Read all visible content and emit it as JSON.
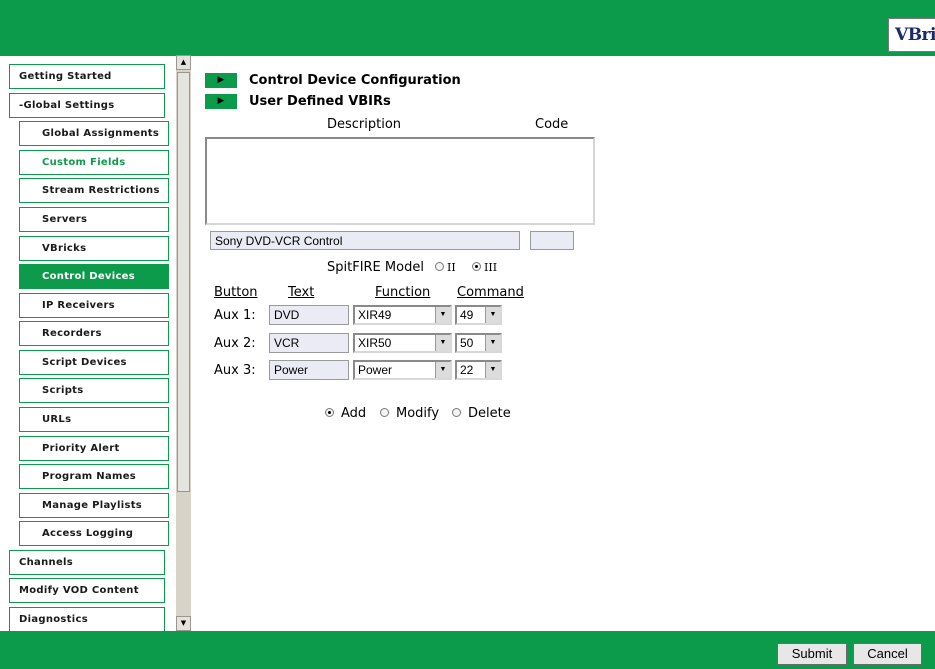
{
  "brand": {
    "logo_text": "VBric",
    "accent_color": "#0b9b4a"
  },
  "sidebar": {
    "items": [
      {
        "label": "Getting Started",
        "level": 0,
        "state": "normal"
      },
      {
        "label": "-Global Settings",
        "level": 1,
        "state": "normal"
      },
      {
        "label": "Global Assignments",
        "level": 1,
        "state": "normal"
      },
      {
        "label": "Custom Fields",
        "level": 1,
        "state": "highlight"
      },
      {
        "label": "Stream Restrictions",
        "level": 1,
        "state": "normal"
      },
      {
        "label": "Servers",
        "level": 1,
        "state": "normal"
      },
      {
        "label": "VBricks",
        "level": 1,
        "state": "normal"
      },
      {
        "label": "Control Devices",
        "level": 1,
        "state": "active"
      },
      {
        "label": "IP Receivers",
        "level": 1,
        "state": "normal"
      },
      {
        "label": "Recorders",
        "level": 1,
        "state": "normal"
      },
      {
        "label": "Script Devices",
        "level": 1,
        "state": "normal"
      },
      {
        "label": "Scripts",
        "level": 1,
        "state": "normal"
      },
      {
        "label": "URLs",
        "level": 1,
        "state": "normal"
      },
      {
        "label": "Priority Alert",
        "level": 1,
        "state": "normal"
      },
      {
        "label": "Program Names",
        "level": 1,
        "state": "normal"
      },
      {
        "label": "Manage Playlists",
        "level": 1,
        "state": "normal"
      },
      {
        "label": "Access Logging",
        "level": 1,
        "state": "normal"
      },
      {
        "label": "Channels",
        "level": 0,
        "state": "normal"
      },
      {
        "label": "Modify VOD Content",
        "level": 0,
        "state": "normal"
      },
      {
        "label": "Diagnostics",
        "level": 0,
        "state": "normal"
      }
    ],
    "scroll_up_icon": "triangle-up",
    "scroll_down_icon": "triangle-down"
  },
  "main": {
    "section1_title": "Control Device Configuration",
    "section2_title": "User Defined VBIRs",
    "section_icon": "play-arrow",
    "col_description": "Description",
    "col_code": "Code",
    "description_value": "Sony DVD-VCR Control",
    "code_value": "",
    "spitfire_label": "SpitFIRE Model",
    "spitfire_options": [
      "II",
      "III"
    ],
    "spitfire_selected": "III",
    "table_headers": {
      "button": "Button",
      "text": "Text",
      "function": "Function",
      "command": "Command"
    },
    "rows": [
      {
        "button": "Aux 1:",
        "text": "DVD",
        "function": "XIR49",
        "command": "49"
      },
      {
        "button": "Aux 2:",
        "text": "VCR",
        "function": "XIR50",
        "command": "50"
      },
      {
        "button": "Aux 3:",
        "text": "Power",
        "function": "Power",
        "command": "22"
      }
    ],
    "action_options": [
      "Add",
      "Modify",
      "Delete"
    ],
    "action_selected": "Add"
  },
  "footer": {
    "submit_label": "Submit",
    "cancel_label": "Cancel"
  }
}
